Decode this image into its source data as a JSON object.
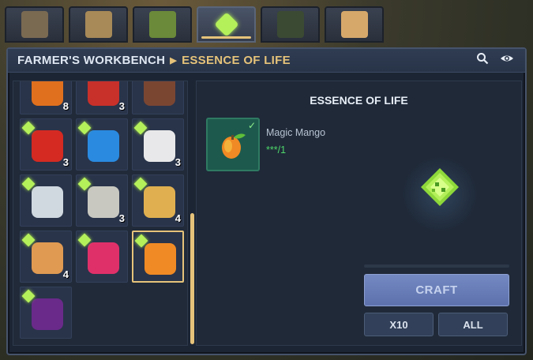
{
  "tabs": [
    {
      "name": "tab-machine",
      "color": "#7a6a52"
    },
    {
      "name": "tab-book",
      "color": "#a88a58"
    },
    {
      "name": "tab-seedling",
      "color": "#6b8a3a"
    },
    {
      "name": "tab-essence",
      "color": "#b4f05a",
      "active": true
    },
    {
      "name": "tab-crate",
      "color": "#3b4a33"
    },
    {
      "name": "tab-wood-block",
      "color": "#d6a86a"
    }
  ],
  "header": {
    "crumb1": "FARMER'S WORKBENCH",
    "crumb2": "ESSENCE OF LIFE",
    "search_icon": "⚲",
    "eye_icon": "◉"
  },
  "inventory": {
    "slots": [
      {
        "name": "pumpkin",
        "count": "8",
        "gem": false,
        "color": "#e0701e"
      },
      {
        "name": "tomato",
        "count": "3",
        "gem": false,
        "color": "#c8302a"
      },
      {
        "name": "wood-log",
        "count": "",
        "gem": false,
        "color": "#7a4632"
      },
      {
        "name": "chili-pepper",
        "count": "3",
        "gem": true,
        "color": "#d42a22"
      },
      {
        "name": "blue-flower",
        "count": "",
        "gem": true,
        "color": "#2a8ae0"
      },
      {
        "name": "cotton",
        "count": "3",
        "gem": true,
        "color": "#e8e8ea"
      },
      {
        "name": "white-flower",
        "count": "",
        "gem": true,
        "color": "#d0d8e0"
      },
      {
        "name": "seeds",
        "count": "3",
        "gem": true,
        "color": "#c8c8c0"
      },
      {
        "name": "cheese-block",
        "count": "4",
        "gem": true,
        "color": "#e0b050"
      },
      {
        "name": "bread-loaf",
        "count": "4",
        "gem": true,
        "color": "#e09a52"
      },
      {
        "name": "pink-berries",
        "count": "",
        "gem": true,
        "color": "#e0306a"
      },
      {
        "name": "magic-mango",
        "count": "",
        "gem": true,
        "color": "#f08a24",
        "selected": true
      },
      {
        "name": "purple-grapes",
        "count": "",
        "gem": true,
        "color": "#6a2a8a"
      }
    ]
  },
  "detail": {
    "title": "ESSENCE OF LIFE",
    "ingredient_name": "Magic Mango",
    "ingredient_qty": "***/1",
    "ingredient_check": "✓",
    "craft_label": "CRAFT",
    "x10_label": "X10",
    "all_label": "ALL"
  },
  "colors": {
    "accent_gold": "#e6c37a",
    "essence_green": "#b4f05a",
    "craft_blue": "#6a7fb8",
    "qty_green": "#4fd86a"
  }
}
